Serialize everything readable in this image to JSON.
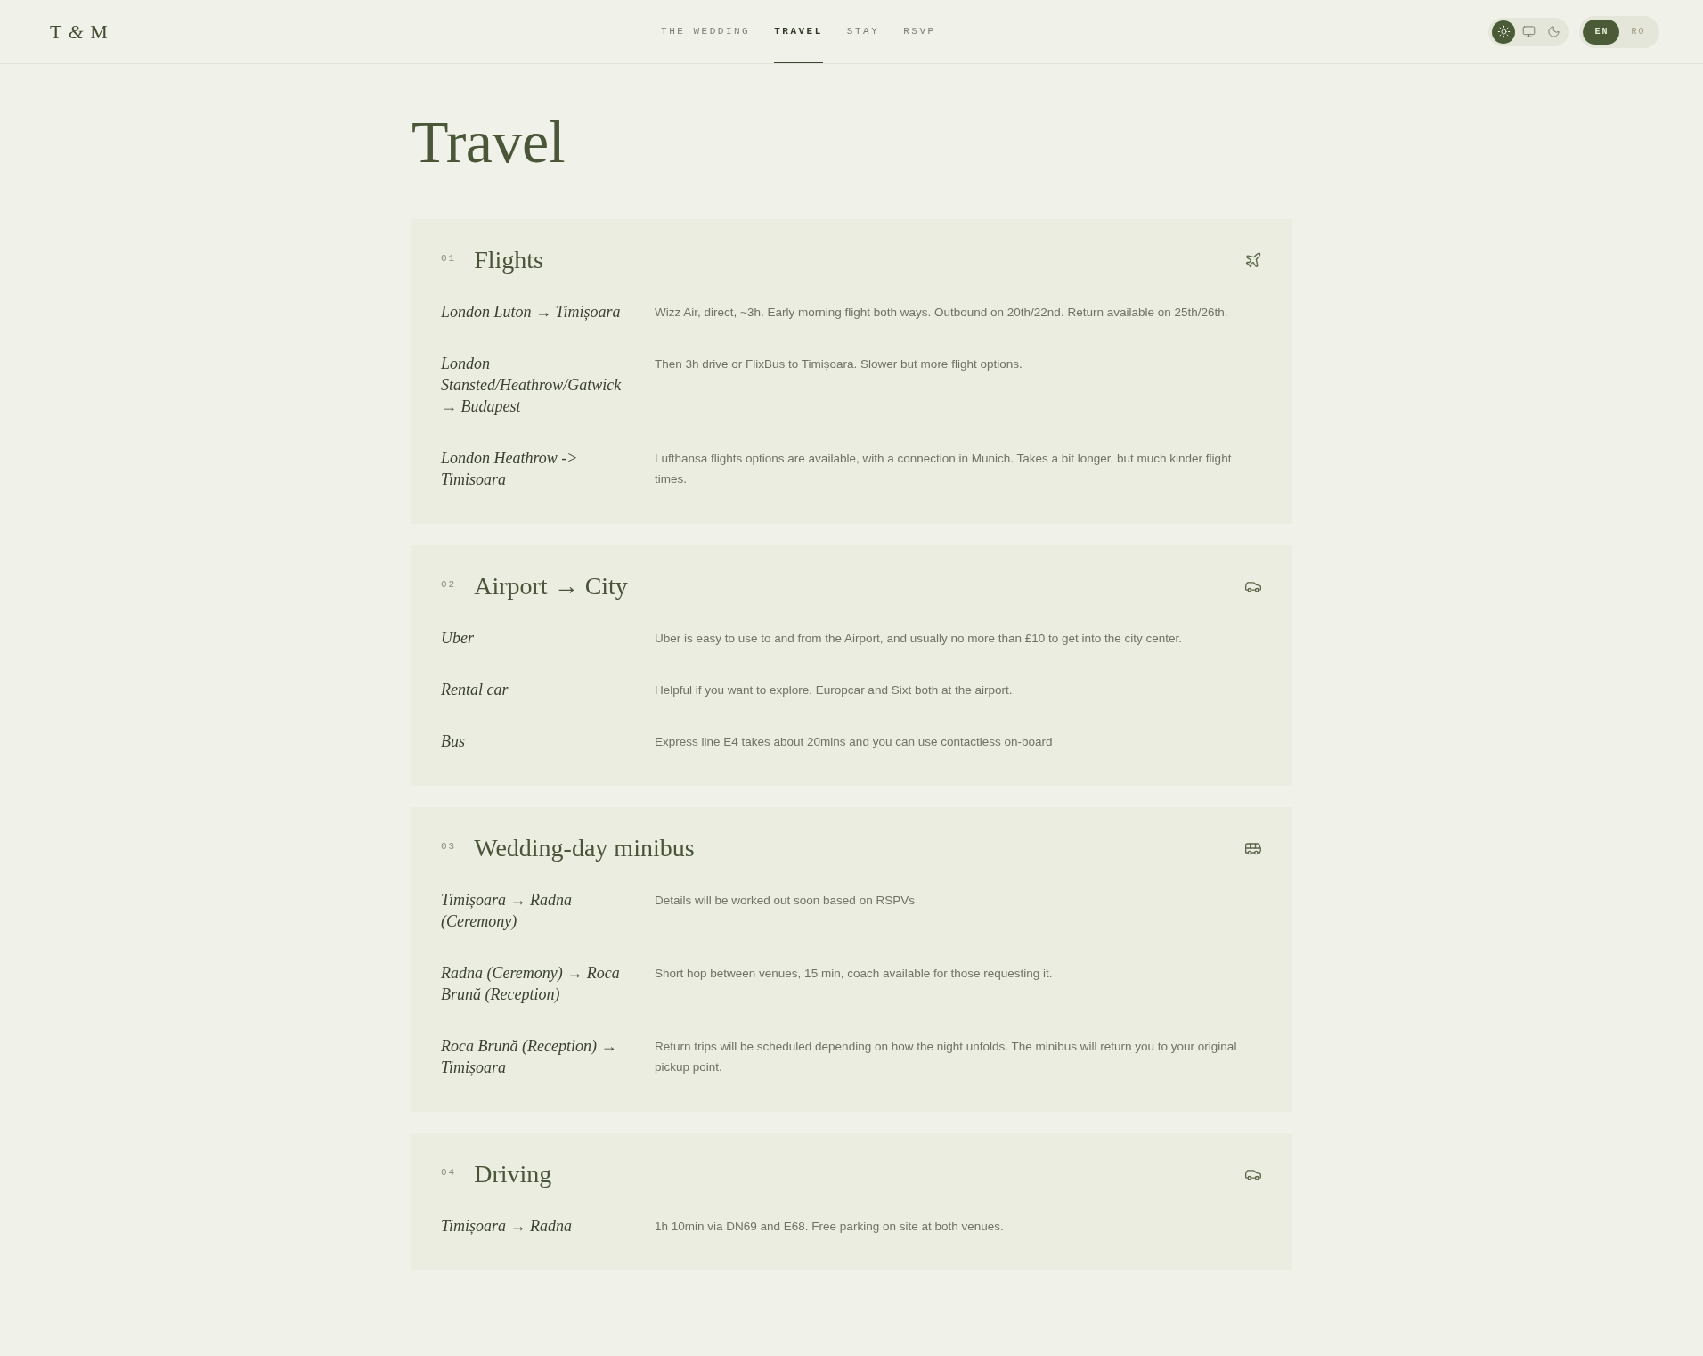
{
  "header": {
    "logo": "T *&* M",
    "nav": [
      {
        "label": "THE WEDDING",
        "selected": false
      },
      {
        "label": "TRAVEL",
        "selected": true
      },
      {
        "label": "STAY",
        "selected": false
      },
      {
        "label": "RSVP",
        "selected": false
      }
    ],
    "theme_switch": [
      {
        "kind": "sun",
        "selected": true
      },
      {
        "kind": "monitor",
        "selected": false
      },
      {
        "kind": "moon",
        "selected": false
      }
    ],
    "language_switch": [
      {
        "label": "EN",
        "selected": true
      },
      {
        "label": "RO",
        "selected": false
      }
    ]
  },
  "page": {
    "title": "Travel"
  },
  "sections": [
    {
      "number": "01",
      "title": "Flights",
      "kind": "plane",
      "rows": [
        {
          "label": "London Luton → Timișoara",
          "text": "Wizz Air, direct, ~3h. Early morning flight both ways. Outbound on 20th/22nd. Return available on 25th/26th."
        },
        {
          "label": "London Stansted/Heathrow/Gatwick → Budapest",
          "text": "Then 3h drive or FlixBus to Timișoara. Slower but more flight options."
        },
        {
          "label": "London Heathrow -> Timisoara",
          "text": "Lufthansa flights options are available, with a connection in Munich. Takes a bit longer, but much kinder flight times."
        }
      ]
    },
    {
      "number": "02",
      "title": "Airport → City",
      "kind": "car",
      "rows": [
        {
          "label": "Uber",
          "text": "Uber is easy to use to and from the Airport, and usually no more than £10 to get into the city center."
        },
        {
          "label": "Rental car",
          "text": "Helpful if you want to explore. Europcar and Sixt both at the airport."
        },
        {
          "label": "Bus",
          "text": "Express line E4 takes about 20mins and you can use contactless on-board"
        }
      ]
    },
    {
      "number": "03",
      "title": "Wedding-day minibus",
      "kind": "bus",
      "rows": [
        {
          "label": "Timișoara → Radna (Ceremony)",
          "text": "Details will be worked out soon based on RSPVs"
        },
        {
          "label": "Radna (Ceremony) → Roca Brună (Reception)",
          "text": "Short hop between venues, 15 min, coach available for those requesting it."
        },
        {
          "label": "Roca Brună (Reception) → Timișoara",
          "text": "Return trips will be scheduled depending on how the night unfolds. The minibus will return you to your original pickup point."
        }
      ]
    },
    {
      "number": "04",
      "title": "Driving",
      "kind": "car",
      "rows": [
        {
          "label": "Timișoara → Radna",
          "text": "1h 10min via DN69 and E68. Free parking on site at both venues."
        }
      ]
    }
  ]
}
